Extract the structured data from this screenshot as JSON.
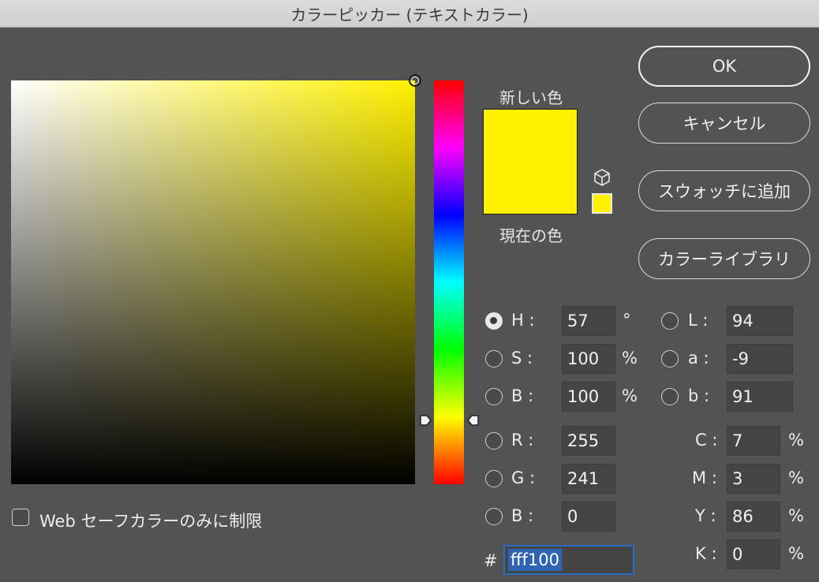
{
  "window": {
    "title": "カラーピッカー (テキストカラー)"
  },
  "buttons": {
    "ok": "OK",
    "cancel": "キャンセル",
    "add_to_swatches": "スウォッチに追加",
    "color_libraries": "カラーライブラリ"
  },
  "swatches": {
    "new_label": "新しい色",
    "current_label": "現在の色",
    "new_color": "#fff100",
    "current_color": "#fff100",
    "websafe_icon": "cube-icon",
    "websafe_color": "#fff100"
  },
  "hsb": {
    "h": {
      "label": "H :",
      "value": "57",
      "unit": "°",
      "selected": true
    },
    "s": {
      "label": "S :",
      "value": "100",
      "unit": "%"
    },
    "b": {
      "label": "B :",
      "value": "100",
      "unit": "%"
    }
  },
  "rgb": {
    "r": {
      "label": "R :",
      "value": "255"
    },
    "g": {
      "label": "G :",
      "value": "241"
    },
    "b": {
      "label": "B :",
      "value": "0"
    }
  },
  "lab": {
    "l": {
      "label": "L :",
      "value": "94"
    },
    "a": {
      "label": "a :",
      "value": "-9"
    },
    "b": {
      "label": "b :",
      "value": "91"
    }
  },
  "cmyk": {
    "c": {
      "label": "C :",
      "value": "7",
      "unit": "%"
    },
    "m": {
      "label": "M :",
      "value": "3",
      "unit": "%"
    },
    "y": {
      "label": "Y :",
      "value": "86",
      "unit": "%"
    },
    "k": {
      "label": "K :",
      "value": "0",
      "unit": "%"
    }
  },
  "hex": {
    "prefix": "#",
    "value": "fff100"
  },
  "web_safe": {
    "label": "Web セーフカラーのみに制限",
    "checked": false
  },
  "picker": {
    "hue_degrees": 57,
    "saturation": 1.0,
    "brightness": 1.0,
    "field_color": "#fff100"
  }
}
